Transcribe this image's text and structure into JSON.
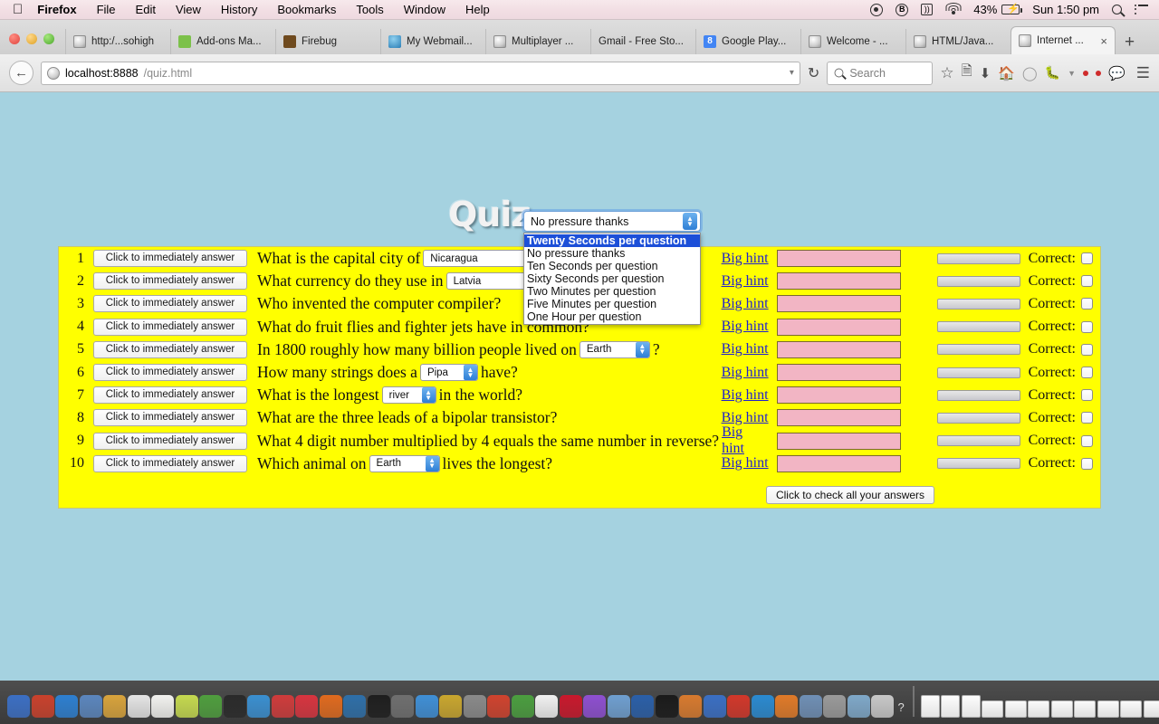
{
  "menubar": {
    "apple_icon": "apple-icon",
    "items": [
      "Firefox",
      "File",
      "Edit",
      "View",
      "History",
      "Bookmarks",
      "Tools",
      "Window",
      "Help"
    ],
    "right": {
      "battery_percent": "43%",
      "clock": "Sun 1:50 pm",
      "icons": [
        "record-circle-icon",
        "bluetooth-b-icon",
        "airplay-icon",
        "wifi-icon",
        "battery-charging-icon",
        "spotlight-search-icon",
        "notification-center-icon"
      ]
    }
  },
  "browser": {
    "window_controls": [
      "close",
      "minimize",
      "zoom"
    ],
    "tabs": [
      {
        "label": "http:/...sohigh",
        "favicon": "globe-icon",
        "active": false
      },
      {
        "label": "Add-ons Ma...",
        "favicon": "puzzle-icon",
        "active": false
      },
      {
        "label": "Firebug",
        "favicon": "bug-icon",
        "active": false
      },
      {
        "label": "My Webmail...",
        "favicon": "mail-icon",
        "active": false
      },
      {
        "label": "Multiplayer ...",
        "favicon": "globe-icon",
        "active": false
      },
      {
        "label": "Gmail - Free Sto...",
        "favicon": "none",
        "active": false
      },
      {
        "label": "Google Play...",
        "favicon": "google-icon",
        "active": false
      },
      {
        "label": "Welcome - ...",
        "favicon": "globe-icon",
        "active": false
      },
      {
        "label": "HTML/Java...",
        "favicon": "globe-icon",
        "active": false
      },
      {
        "label": "Internet ...",
        "favicon": "globe-icon",
        "active": true,
        "close_label": "×"
      }
    ],
    "new_tab_label": "+",
    "back_arrow": "←",
    "url_host": "localhost:8888",
    "url_path": "/quiz.html",
    "url_full": "localhost:8888/quiz.html",
    "search_placeholder": "Search",
    "dropdown_marker": "▾",
    "reload_label": "↻",
    "toolbar_icons": [
      "bookmark-star-icon",
      "reader-list-icon",
      "downloads-icon",
      "home-icon",
      "sync-icon",
      "firebug-icon",
      "chevron-down-icon",
      "pocket-dot-icon",
      "red-dot-icon",
      "chat-icon",
      "hamburger-menu-icon"
    ]
  },
  "page": {
    "title": "Quiz",
    "background_color": "#a5d2e0",
    "panel_color": "#ffff00",
    "answer_box_color": "#f2b5c4",
    "timer_select": {
      "selected": "No pressure thanks",
      "open": true,
      "highlighted": "Twenty Seconds per question",
      "options": [
        "Twenty Seconds per question",
        "No pressure thanks",
        "Ten Seconds per question",
        "Sixty Seconds per question",
        "Two Minutes per question",
        "Five Minutes per question",
        "One Hour per question"
      ]
    },
    "immediate_button_label": "Click to immediately answer",
    "hint_label": "Big hint",
    "correct_label": "Correct:",
    "check_all_label": "Click to check all your answers",
    "rows": [
      {
        "num": "1",
        "text_before": "What is the capital city of",
        "control": {
          "type": "select",
          "value": "Nicaragua",
          "width": 150,
          "arrow": false
        },
        "text_after": "",
        "progress": 12
      },
      {
        "num": "2",
        "text_before": "What currency do they use in",
        "control": {
          "type": "select",
          "value": "Latvia",
          "width": 108,
          "arrow": true
        },
        "text_after": "?",
        "progress": 0
      },
      {
        "num": "3",
        "text_before": "Who invented the computer compiler?",
        "control": null,
        "text_after": "",
        "progress": 0
      },
      {
        "num": "4",
        "text_before": "What do fruit flies and fighter jets have in common?",
        "control": null,
        "text_after": "",
        "progress": 0
      },
      {
        "num": "5",
        "text_before": "In 1800 roughly how many billion people lived on",
        "control": {
          "type": "select",
          "value": "Earth",
          "width": 78,
          "arrow": true
        },
        "text_after": "?",
        "progress": 0
      },
      {
        "num": "6",
        "text_before": "How many strings does a",
        "control": {
          "type": "select",
          "value": "Pipa",
          "width": 64,
          "arrow": true
        },
        "text_after": "have?",
        "progress": 0
      },
      {
        "num": "7",
        "text_before": "What is the longest",
        "control": {
          "type": "select",
          "value": "river",
          "width": 60,
          "arrow": true
        },
        "text_after": "in the world?",
        "progress": 0
      },
      {
        "num": "8",
        "text_before": "What are the three leads of a bipolar transistor?",
        "control": null,
        "text_after": "",
        "progress": 0
      },
      {
        "num": "9",
        "text_before": "What 4 digit number multiplied by 4 equals the same number in reverse?",
        "control": null,
        "text_after": "",
        "progress": 0
      },
      {
        "num": "10",
        "text_before": "Which animal on",
        "control": {
          "type": "select",
          "value": "Earth",
          "width": 78,
          "arrow": true
        },
        "text_after": "lives the longest?",
        "progress": 0
      }
    ]
  },
  "dock": {
    "left_icon_colors": [
      "#3b6fc4",
      "#c9412c",
      "#2d7fd0",
      "#5b86bd",
      "#d8a33c",
      "#e4e4e4",
      "#f2f2ef",
      "#c5d94f",
      "#4f9e3e",
      "#2a2a2a",
      "#3a8fd0",
      "#cf3b3b",
      "#d8343f",
      "#e06a1e",
      "#2e6fa8",
      "#1e1e1e",
      "#6f6f6f",
      "#3f8fd6",
      "#c9a62e",
      "#8a8a8a",
      "#d0432e",
      "#4b9e3f",
      "#f1f1f1",
      "#c9182c",
      "#8e4fd0",
      "#6f9fd0",
      "#2a5fa8",
      "#1a1a1a",
      "#d87a2e",
      "#3a6fc4"
    ],
    "right_icon_colors": [
      "#d2372a",
      "#2a8ad0",
      "#e07a28",
      "#6f8fb5",
      "#9a9a9a",
      "#7fa8c9",
      "#c8c8c8"
    ],
    "question_label": "?"
  }
}
